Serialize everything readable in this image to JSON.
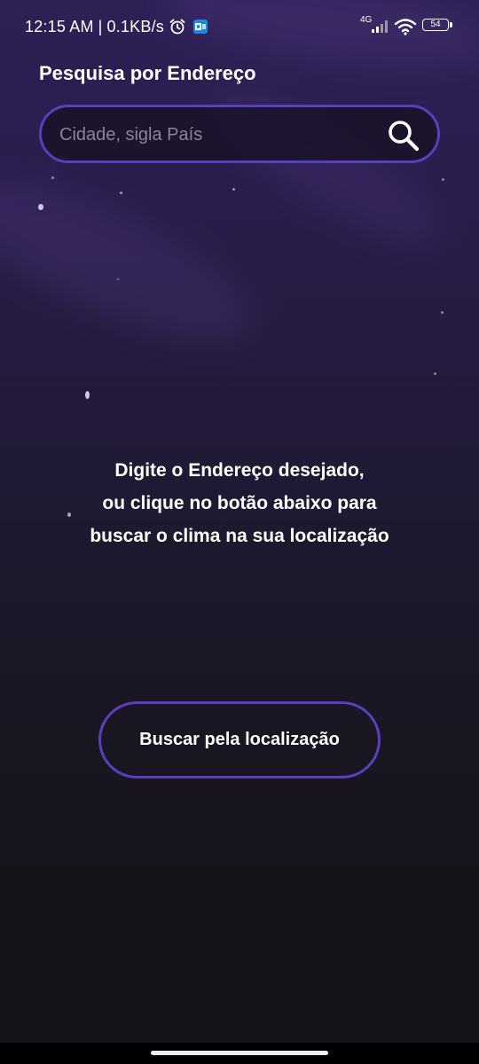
{
  "status_bar": {
    "time": "12:15 AM",
    "separator": "|",
    "network_speed": "0.1KB/s",
    "network_type": "4G",
    "battery_level": "54",
    "icons": [
      "alarm-icon",
      "outlook-icon",
      "signal-icon",
      "wifi-icon",
      "battery-icon"
    ]
  },
  "header": {
    "title": "Pesquisa por Endereço"
  },
  "search": {
    "placeholder": "Cidade, sigla País",
    "value": "",
    "icon": "search-icon"
  },
  "instructions": {
    "lines": [
      "Digite o Endereço desejado,",
      "ou clique no botão abaixo para",
      "buscar o clima na sua localização"
    ]
  },
  "location_button": {
    "label": "Buscar pela localização"
  },
  "colors": {
    "accent": "#5b3ec0",
    "background_top": "#2e1f55",
    "background_bottom": "#141317",
    "text": "#ffffff",
    "placeholder": "#8a8598"
  }
}
